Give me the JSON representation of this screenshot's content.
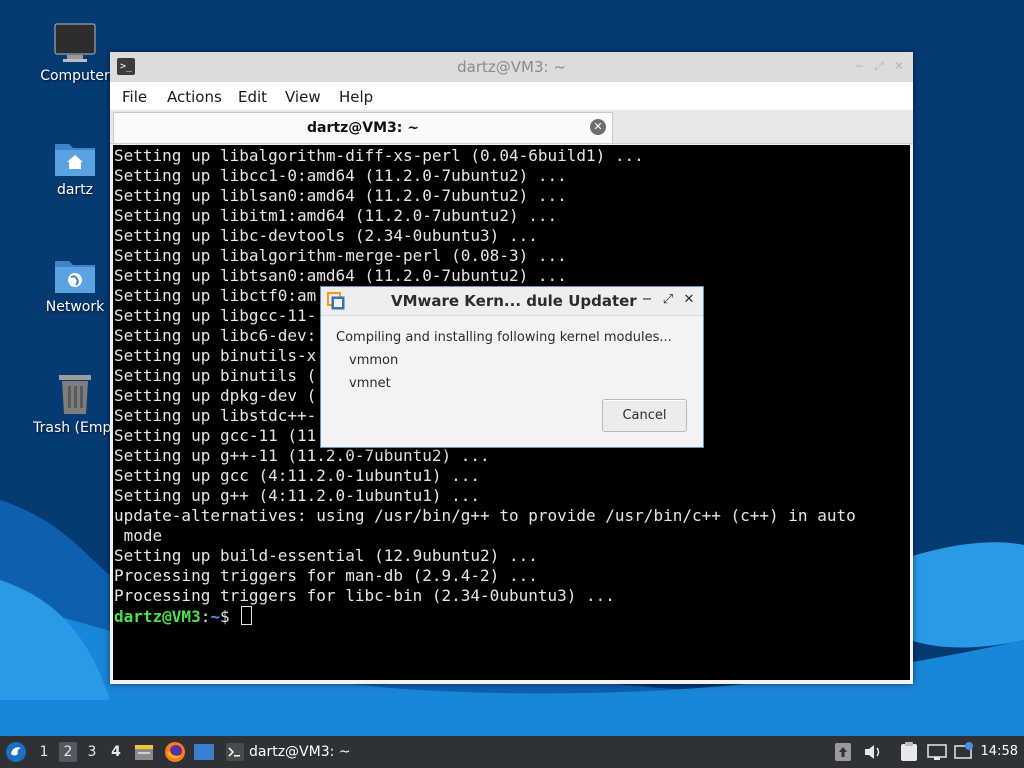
{
  "desktop": {
    "icons": [
      {
        "label": "Computer",
        "icon": "computer-icon"
      },
      {
        "label": "dartz",
        "icon": "home-folder-icon"
      },
      {
        "label": "Network",
        "icon": "network-folder-icon"
      },
      {
        "label": "Trash (Empt",
        "icon": "trash-icon"
      }
    ]
  },
  "terminal": {
    "window_title": "dartz@VM3: ~",
    "menu": [
      "File",
      "Actions",
      "Edit",
      "View",
      "Help"
    ],
    "tab_title": "dartz@VM3: ~",
    "lines": [
      "Setting up libalgorithm-diff-xs-perl (0.04-6build1) ...",
      "Setting up libcc1-0:amd64 (11.2.0-7ubuntu2) ...",
      "Setting up liblsan0:amd64 (11.2.0-7ubuntu2) ...",
      "Setting up libitm1:amd64 (11.2.0-7ubuntu2) ...",
      "Setting up libc-devtools (2.34-0ubuntu3) ...",
      "Setting up libalgorithm-merge-perl (0.08-3) ...",
      "Setting up libtsan0:amd64 (11.2.0-7ubuntu2) ...",
      "Setting up libctf0:am",
      "Setting up libgcc-11-",
      "Setting up libc6-dev:",
      "Setting up binutils-x",
      "Setting up binutils (",
      "Setting up dpkg-dev (",
      "Setting up libstdc++-",
      "Setting up gcc-11 (11",
      "Setting up g++-11 (11.2.0-7ubuntu2) ...",
      "Setting up gcc (4:11.2.0-1ubuntu1) ...",
      "Setting up g++ (4:11.2.0-1ubuntu1) ...",
      "update-alternatives: using /usr/bin/g++ to provide /usr/bin/c++ (c++) in auto",
      " mode",
      "Setting up build-essential (12.9ubuntu2) ...",
      "Processing triggers for man-db (2.9.4-2) ...",
      "Processing triggers for libc-bin (2.34-0ubuntu3) ..."
    ],
    "prompt_user": "dartz@VM3",
    "prompt_sep": ":",
    "prompt_path": "~",
    "prompt_symbol": "$ "
  },
  "dialog": {
    "title": "VMware Kern... dule Updater",
    "message": "Compiling and installing following kernel modules...",
    "modules": [
      "vmmon",
      "vmnet"
    ],
    "cancel_label": "Cancel"
  },
  "taskbar": {
    "workspaces": [
      "1",
      "2",
      "3",
      "4"
    ],
    "active_workspace": "2",
    "task_label": "dartz@VM3: ~",
    "clock": "14:58"
  },
  "colors": {
    "desktop_dark": "#063a73",
    "desktop_wave": "#1a86d8",
    "terminal_bg": "#000000",
    "prompt_user": "#4be24b",
    "prompt_path": "#5c8cff",
    "taskbar_bg": "#2e3136"
  }
}
